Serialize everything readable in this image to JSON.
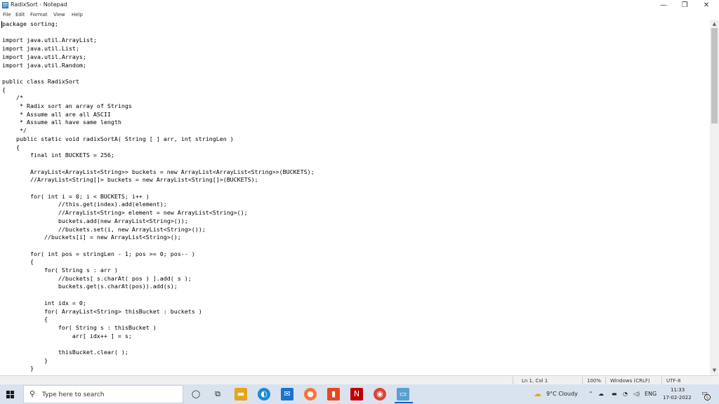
{
  "window": {
    "title": "RadixSort - Notepad",
    "minimize_glyph": "—",
    "maximize_glyph": "❐",
    "close_glyph": "✕"
  },
  "menu": [
    "File",
    "Edit",
    "Format",
    "View",
    "Help"
  ],
  "editor": {
    "lines": [
      "package sorting;",
      "",
      "import java.util.ArrayList;",
      "import java.util.List;",
      "import java.util.Arrays;",
      "import java.util.Random;",
      "",
      "public class RadixSort",
      "{",
      "    /*",
      "     * Radix sort an array of Strings",
      "     * Assume all are all ASCII",
      "     * Assume all have same length",
      "     */",
      "    public static void radixSortA( String [ ] arr, int stringLen )",
      "    {",
      "        final int BUCKETS = 256;",
      "",
      "        ArrayList<ArrayList<String>> buckets = new ArrayList<ArrayList<String>>(BUCKETS);",
      "        //ArrayList<String[]> buckets = new ArrayList<String[]>(BUCKETS);",
      "",
      "        for( int i = 0; i < BUCKETS; i++ )",
      "                //this.get(index).add(element);",
      "                //ArrayList<String> element = new ArrayList<String>();",
      "                buckets.add(new ArrayList<String>());",
      "                //buckets.set(i, new ArrayList<String>());",
      "            //buckets[i] = new ArrayList<String>();",
      "",
      "        for( int pos = stringLen - 1; pos >= 0; pos-- )",
      "        {",
      "            for( String s : arr )",
      "                //buckets[ s.charAt( pos ) ].add( s );",
      "                buckets.get(s.charAt(pos)).add(s);",
      "",
      "            int idx = 0;",
      "            for( ArrayList<String> thisBucket : buckets )",
      "            {",
      "                for( String s : thisBucket )",
      "                    arr[ idx++ ] = s;",
      "",
      "                thisBucket.clear( );",
      "            }",
      "        }"
    ]
  },
  "status": {
    "position": "Ln 1, Col 1",
    "zoom": "100%",
    "line_ending": "Windows (CRLF)",
    "encoding": "UTF-8"
  },
  "taskbar": {
    "search_placeholder": "Type here to search",
    "apps": [
      {
        "name": "cortana-icon",
        "glyph": "◯",
        "color": "#222222"
      },
      {
        "name": "task-view-icon",
        "glyph": "⧉",
        "color": "#222222"
      },
      {
        "name": "file-explorer-icon",
        "glyph": "▬",
        "color": "#e8a317"
      },
      {
        "name": "edge-icon",
        "glyph": "◐",
        "color": "#1c8ad8"
      },
      {
        "name": "mail-icon",
        "glyph": "✉",
        "color": "#1a73d0"
      },
      {
        "name": "firefox-icon",
        "glyph": "●",
        "color": "#ff7139"
      },
      {
        "name": "office-icon",
        "glyph": "▮",
        "color": "#e8461d"
      },
      {
        "name": "app-icon-dark",
        "glyph": "N",
        "color": "#c00000"
      },
      {
        "name": "chrome-icon",
        "glyph": "◉",
        "color": "#db4437"
      },
      {
        "name": "notepad-icon",
        "glyph": "▭",
        "color": "#5aa0d0"
      }
    ],
    "weather": "9°C  Cloudy",
    "language": "ENG",
    "time": "11:33",
    "date": "17-02-2022",
    "notification_count": "5"
  }
}
